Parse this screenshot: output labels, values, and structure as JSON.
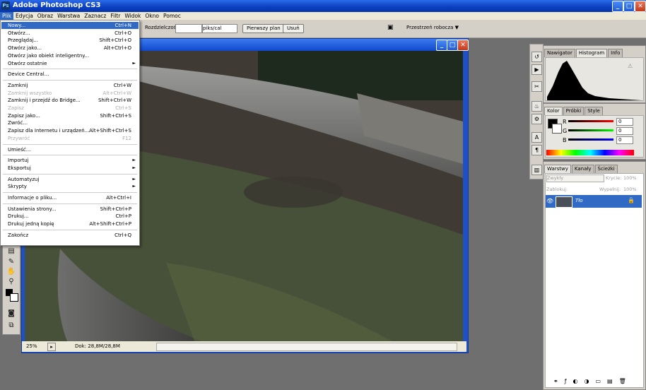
{
  "app": {
    "title": "Adobe Photoshop CS3",
    "logo": "Ps"
  },
  "menubar": [
    "Plik",
    "Edycja",
    "Obraz",
    "Warstwa",
    "Zaznacz",
    "Filtr",
    "Widok",
    "Okno",
    "Pomoc"
  ],
  "options": {
    "resolution_label": "Rozdzielczość:",
    "resolution_unit": "piks/cal",
    "front_image_btn": "Pierwszy plan",
    "clear_btn": "Usuń",
    "workspace": "Przestrzeń robocza ▼"
  },
  "file_menu": [
    {
      "label": "Nowy...",
      "shortcut": "Ctrl+N",
      "state": "selected"
    },
    {
      "label": "Otwórz...",
      "shortcut": "Ctrl+O"
    },
    {
      "label": "Przeglądaj...",
      "shortcut": "Shift+Ctrl+O"
    },
    {
      "label": "Otwórz jako...",
      "shortcut": "Alt+Ctrl+O"
    },
    {
      "label": "Otwórz jako obiekt inteligentny..."
    },
    {
      "label": "Otwórz ostatnie",
      "submenu": true
    },
    {
      "sep": true
    },
    {
      "label": "Device Central..."
    },
    {
      "sep": true
    },
    {
      "label": "Zamknij",
      "shortcut": "Ctrl+W"
    },
    {
      "label": "Zamknij wszystko",
      "shortcut": "Alt+Ctrl+W",
      "state": "disabled"
    },
    {
      "label": "Zamknij i przejdź do Bridge...",
      "shortcut": "Shift+Ctrl+W"
    },
    {
      "label": "Zapisz",
      "shortcut": "Ctrl+S",
      "state": "disabled"
    },
    {
      "label": "Zapisz jako...",
      "shortcut": "Shift+Ctrl+S"
    },
    {
      "label": "Zwróć..."
    },
    {
      "label": "Zapisz dla Internetu i urządzeń...",
      "shortcut": "Alt+Shift+Ctrl+S"
    },
    {
      "label": "Przywróć",
      "shortcut": "F12",
      "state": "disabled"
    },
    {
      "sep": true
    },
    {
      "label": "Umieść..."
    },
    {
      "sep": true
    },
    {
      "label": "Importuj",
      "submenu": true
    },
    {
      "label": "Eksportuj",
      "submenu": true
    },
    {
      "sep": true
    },
    {
      "label": "Automatyzuj",
      "submenu": true
    },
    {
      "label": "Skrypty",
      "submenu": true
    },
    {
      "sep": true
    },
    {
      "label": "Informacje o pliku...",
      "shortcut": "Alt+Ctrl+I"
    },
    {
      "sep": true
    },
    {
      "label": "Ustawienia strony...",
      "shortcut": "Shift+Ctrl+P"
    },
    {
      "label": "Drukuj...",
      "shortcut": "Ctrl+P"
    },
    {
      "label": "Drukuj jedną kopię",
      "shortcut": "Alt+Shift+Ctrl+P"
    },
    {
      "sep": true
    },
    {
      "label": "Zakończ",
      "shortcut": "Ctrl+Q"
    }
  ],
  "document": {
    "zoom": "25%",
    "doc_info": "Dok: 28,8M/28,8M"
  },
  "panels": {
    "nav_tabs": [
      "Nawigator",
      "Histogram",
      "Info"
    ],
    "color_tabs": [
      "Kolor",
      "Próbki",
      "Style"
    ],
    "color": {
      "r_label": "R",
      "g_label": "G",
      "b_label": "B",
      "r": "0",
      "g": "0",
      "b": "0"
    },
    "layers_tabs": [
      "Warstwy",
      "Kanały",
      "Ścieżki"
    ],
    "blend_mode": "Zwykły",
    "opacity_label": "Krycie:",
    "opacity": "100%",
    "lock_label": "Zablokuj:",
    "fill_label": "Wypełnij:",
    "fill": "100%",
    "layer_name": "Tło"
  },
  "colors": {
    "selection": "#316ac5",
    "titlebar": "#0a3fc0"
  }
}
